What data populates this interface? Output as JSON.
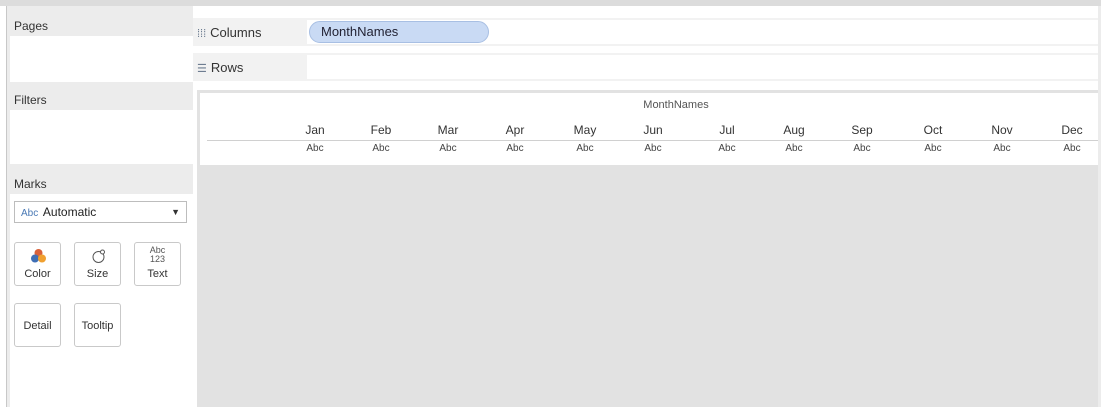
{
  "shelves": {
    "pages_label": "Pages",
    "filters_label": "Filters",
    "columns_label": "Columns",
    "rows_label": "Rows",
    "columns_pill": "MonthNames"
  },
  "marks": {
    "title": "Marks",
    "type_prefix": "Abc",
    "type_value": "Automatic",
    "buttons": [
      {
        "label": "Color",
        "icon": "color-icon"
      },
      {
        "label": "Size",
        "icon": "size-icon"
      },
      {
        "label": "Text",
        "icon": "text-icon"
      },
      {
        "label": "Detail",
        "icon": ""
      },
      {
        "label": "Tooltip",
        "icon": ""
      }
    ],
    "text_icon_top": "Abc",
    "text_icon_bottom": "123"
  },
  "view": {
    "column_title": "MonthNames",
    "months": [
      "Jan",
      "Feb",
      "Mar",
      "Apr",
      "May",
      "Jun",
      "Jul",
      "Aug",
      "Sep",
      "Oct",
      "Nov",
      "Dec"
    ],
    "values": [
      "Abc",
      "Abc",
      "Abc",
      "Abc",
      "Abc",
      "Abc",
      "Abc",
      "Abc",
      "Abc",
      "Abc",
      "Abc",
      "Abc"
    ]
  },
  "colors": {
    "pill_fill": "#c9daf4",
    "color_icon_red": "#d9623a",
    "color_icon_blue": "#3f6fb5",
    "color_icon_orange": "#f0a030"
  }
}
